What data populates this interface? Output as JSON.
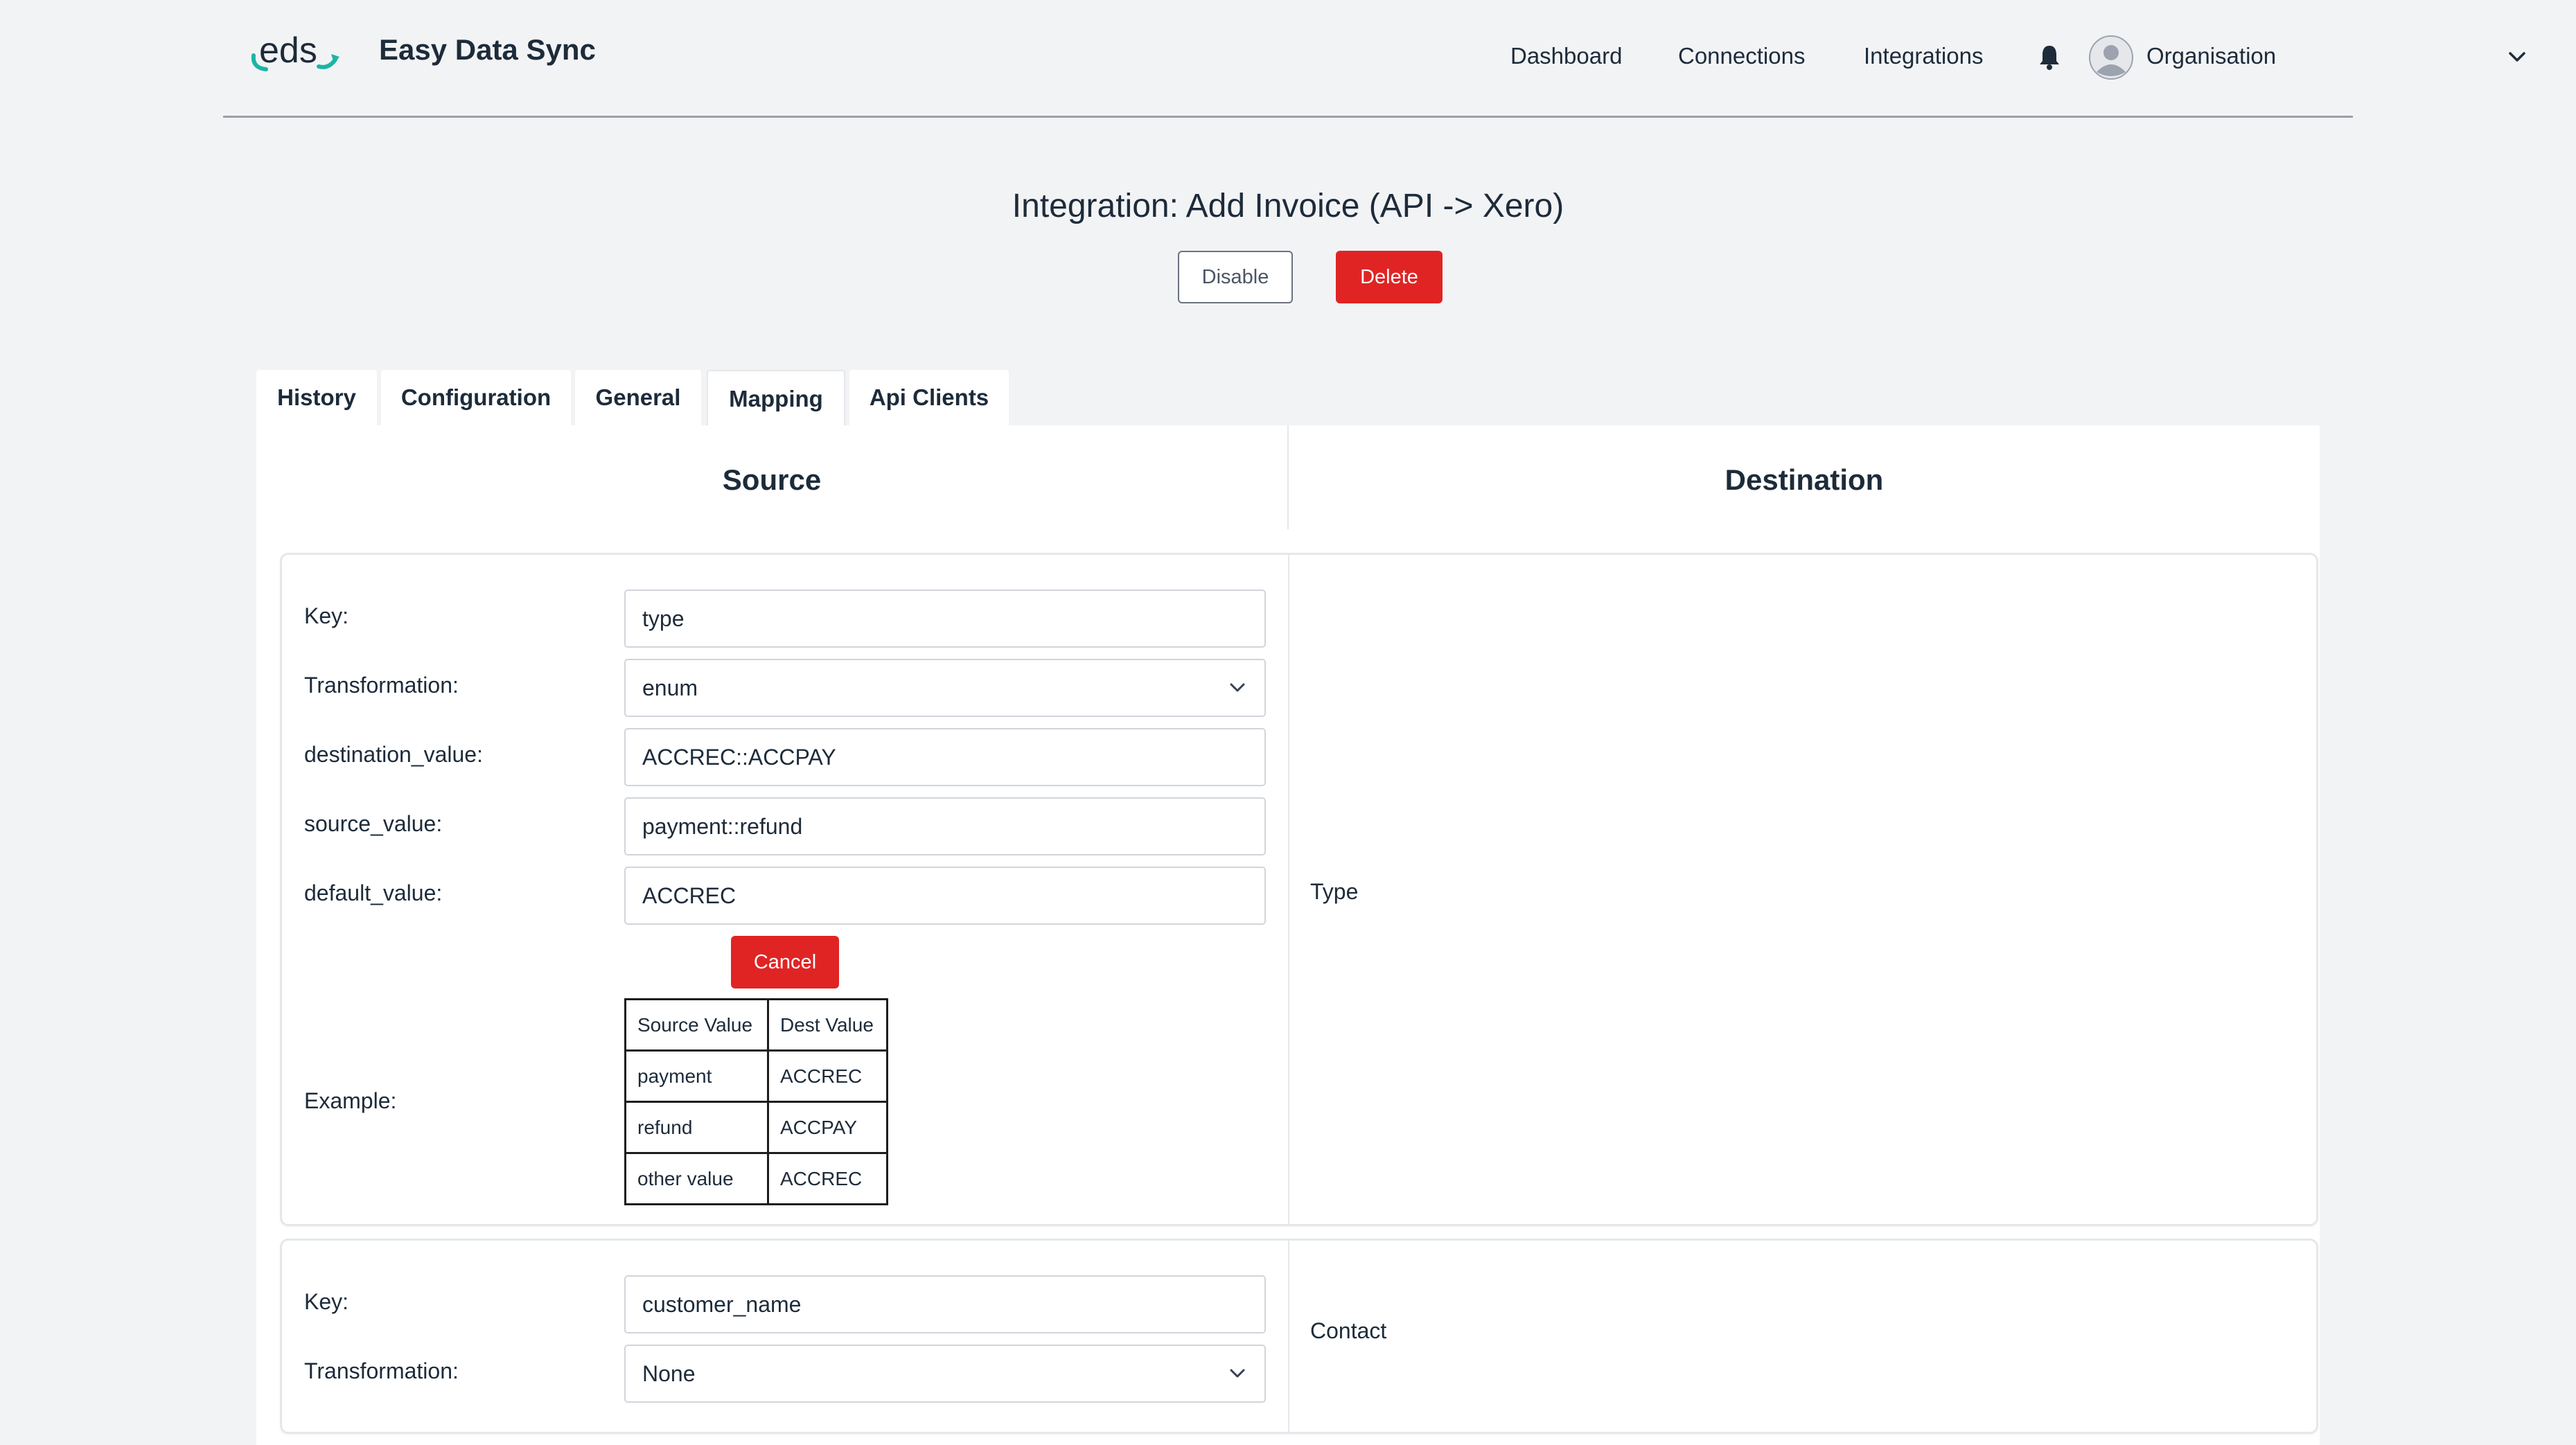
{
  "header": {
    "brand": "Easy Data Sync",
    "logo_text": "eds",
    "nav": [
      "Dashboard",
      "Connections",
      "Integrations"
    ],
    "org_label": "Organisation",
    "icons": {
      "bell": "bell-icon",
      "avatar": "user-avatar-icon",
      "chevron": "chevron-down-icon"
    }
  },
  "page": {
    "title": "Integration: Add Invoice (API -> Xero)",
    "disable_label": "Disable",
    "delete_label": "Delete"
  },
  "tabs": [
    {
      "label": "History",
      "active": false
    },
    {
      "label": "Configuration",
      "active": false
    },
    {
      "label": "General",
      "active": false
    },
    {
      "label": "Mapping",
      "active": true
    },
    {
      "label": "Api Clients",
      "active": false
    }
  ],
  "columns": {
    "source": "Source",
    "destination": "Destination"
  },
  "mappings": [
    {
      "fields": [
        {
          "label": "Key:",
          "value": "type",
          "type": "input"
        },
        {
          "label": "Transformation:",
          "value": "enum",
          "type": "select"
        },
        {
          "label": "destination_value:",
          "value": "ACCREC::ACCPAY",
          "type": "input"
        },
        {
          "label": "source_value:",
          "value": "payment::refund",
          "type": "input"
        },
        {
          "label": "default_value:",
          "value": "ACCREC",
          "type": "input"
        }
      ],
      "cancel_label": "Cancel",
      "example_label": "Example:",
      "example_headers": [
        "Source Value",
        "Dest Value"
      ],
      "example_rows": [
        [
          "payment",
          "ACCREC"
        ],
        [
          "refund",
          "ACCPAY"
        ],
        [
          "other value",
          "ACCREC"
        ]
      ],
      "destination": "Type"
    },
    {
      "fields": [
        {
          "label": "Key:",
          "value": "customer_name",
          "type": "input"
        },
        {
          "label": "Transformation:",
          "value": "None",
          "type": "select"
        }
      ],
      "destination": "Contact"
    }
  ],
  "colors": {
    "accent_red": "#e02424",
    "logo_teal": "#1bb5a5",
    "text_dark": "#1d2b3a"
  }
}
